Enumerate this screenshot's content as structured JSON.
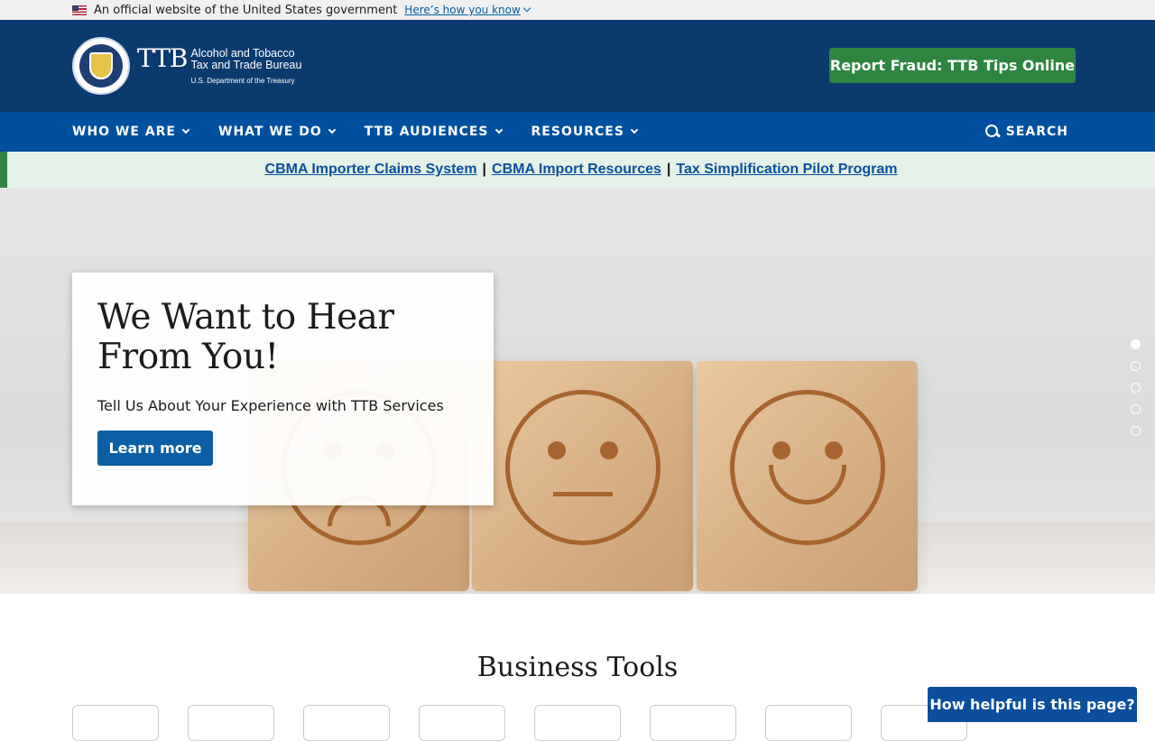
{
  "gov_banner": {
    "text": "An official website of the United States government",
    "link": "Here’s how you know"
  },
  "header": {
    "logo_abbr": "TTB",
    "logo_line1": "Alcohol and Tobacco",
    "logo_line2": "Tax and Trade Bureau",
    "logo_line3": "U.S. Department of the Treasury",
    "report_button": "Report Fraud: TTB Tips Online"
  },
  "nav": {
    "items": [
      {
        "label": "WHO WE ARE"
      },
      {
        "label": "WHAT WE DO"
      },
      {
        "label": "TTB AUDIENCES"
      },
      {
        "label": "RESOURCES"
      }
    ],
    "search_label": "SEARCH"
  },
  "alert": {
    "links": [
      {
        "label": "CBMA Importer Claims System"
      },
      {
        "label": "CBMA Import Resources"
      },
      {
        "label": "Tax Simplification Pilot Program"
      }
    ],
    "separator": "|"
  },
  "hero": {
    "title": "We Want to Hear From You!",
    "subtitle": "Tell Us About Your Experience with TTB Services",
    "button": "Learn more",
    "slides": 5,
    "active_slide": 1
  },
  "business_tools": {
    "title": "Business Tools"
  },
  "feedback_button": "How helpful is this page?",
  "colors": {
    "header_bg": "#0b3a6e",
    "nav_bg": "#0050a0",
    "report_green": "#2e8540",
    "alert_bg": "#e3f1e8"
  }
}
